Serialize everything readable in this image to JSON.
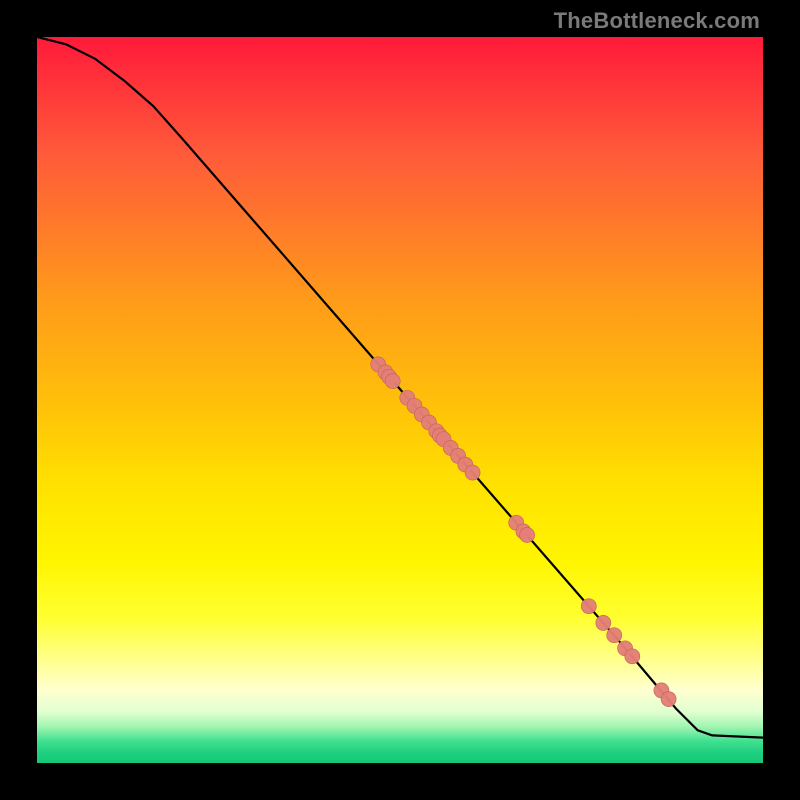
{
  "watermark": "TheBottleneck.com",
  "chart_data": {
    "type": "line",
    "title": "",
    "xlabel": "",
    "ylabel": "",
    "xlim": [
      0,
      100
    ],
    "ylim": [
      0,
      100
    ],
    "curve": [
      {
        "x": 0,
        "y": 100
      },
      {
        "x": 4,
        "y": 99
      },
      {
        "x": 8,
        "y": 97
      },
      {
        "x": 12,
        "y": 94
      },
      {
        "x": 16,
        "y": 90.5
      },
      {
        "x": 20,
        "y": 86
      },
      {
        "x": 30,
        "y": 74.5
      },
      {
        "x": 40,
        "y": 63
      },
      {
        "x": 50,
        "y": 51.5
      },
      {
        "x": 60,
        "y": 40
      },
      {
        "x": 70,
        "y": 28.5
      },
      {
        "x": 80,
        "y": 17
      },
      {
        "x": 88,
        "y": 7.5
      },
      {
        "x": 91,
        "y": 4.5
      },
      {
        "x": 93,
        "y": 3.8
      },
      {
        "x": 100,
        "y": 3.5
      }
    ],
    "markers": [
      {
        "x": 47,
        "y": 54.9
      },
      {
        "x": 48,
        "y": 53.8
      },
      {
        "x": 48.5,
        "y": 53.2
      },
      {
        "x": 49,
        "y": 52.6
      },
      {
        "x": 51,
        "y": 50.3
      },
      {
        "x": 52,
        "y": 49.2
      },
      {
        "x": 53,
        "y": 48.0
      },
      {
        "x": 54,
        "y": 46.9
      },
      {
        "x": 55,
        "y": 45.7
      },
      {
        "x": 55.5,
        "y": 45.1
      },
      {
        "x": 56,
        "y": 44.6
      },
      {
        "x": 57,
        "y": 43.4
      },
      {
        "x": 58,
        "y": 42.3
      },
      {
        "x": 59,
        "y": 41.1
      },
      {
        "x": 60,
        "y": 40.0
      },
      {
        "x": 66,
        "y": 33.1
      },
      {
        "x": 67,
        "y": 31.9
      },
      {
        "x": 67.5,
        "y": 31.4
      },
      {
        "x": 76,
        "y": 21.6
      },
      {
        "x": 78,
        "y": 19.3
      },
      {
        "x": 79.5,
        "y": 17.6
      },
      {
        "x": 81,
        "y": 15.8
      },
      {
        "x": 82,
        "y": 14.7
      },
      {
        "x": 86,
        "y": 10.0
      },
      {
        "x": 87,
        "y": 8.8
      }
    ],
    "colors": {
      "line": "#000000",
      "marker_fill": "#e37f77",
      "marker_stroke": "#c9655d"
    }
  }
}
